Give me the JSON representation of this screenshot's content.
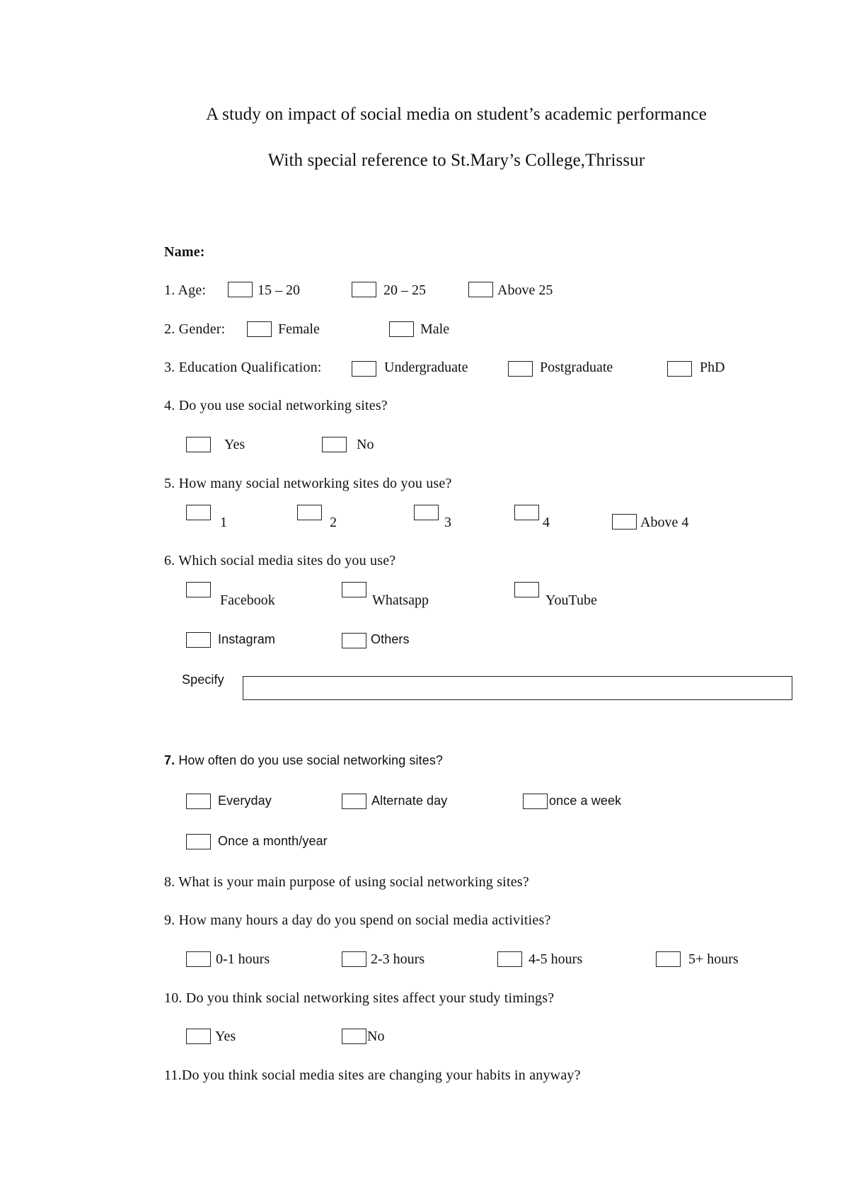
{
  "document": {
    "title": "A study on impact of social media on student’s academic performance",
    "subtitle": "With special reference to St.Mary’s College,Thrissur"
  },
  "name_label": "Name:",
  "questions": [
    {
      "text": "1. Age:",
      "options": [
        "15 – 20",
        "20 – 25",
        "Above 25"
      ]
    },
    {
      "text": "2. Gender:",
      "options": [
        "Female",
        "Male"
      ]
    },
    {
      "text": "3. Education Qualification:",
      "options": [
        "Undergraduate",
        "Postgraduate",
        "PhD"
      ]
    },
    {
      "text": "4. Do you use social networking sites?",
      "options": [
        "Yes",
        "No"
      ]
    },
    {
      "text": "5. How many social networking sites do you use?",
      "options": [
        "1",
        "2",
        "3",
        "4",
        "Above 4"
      ]
    },
    {
      "text": "6. Which social media sites do you use?",
      "options": [
        "Facebook",
        "Whatsapp",
        "YouTube",
        "Instagram",
        "Others"
      ],
      "specify_label": "Specify",
      "specify_value": ""
    },
    {
      "number": "7.",
      "text": "How often do you use social networking sites?",
      "options": [
        "Everyday",
        "Alternate day",
        "once a week",
        "Once a month/year"
      ]
    },
    {
      "text": "8. What is your main purpose of using social networking sites?"
    },
    {
      "text": "9. How many hours a day do you spend on social media activities?",
      "options": [
        "0-1 hours",
        "2-3 hours",
        "4-5 hours",
        "5+ hours"
      ]
    },
    {
      "text": "10. Do you think social networking sites affect your study timings?",
      "options": [
        "Yes",
        "No"
      ]
    },
    {
      "text": "11.Do you think social media sites are changing your habits in anyway?"
    }
  ]
}
